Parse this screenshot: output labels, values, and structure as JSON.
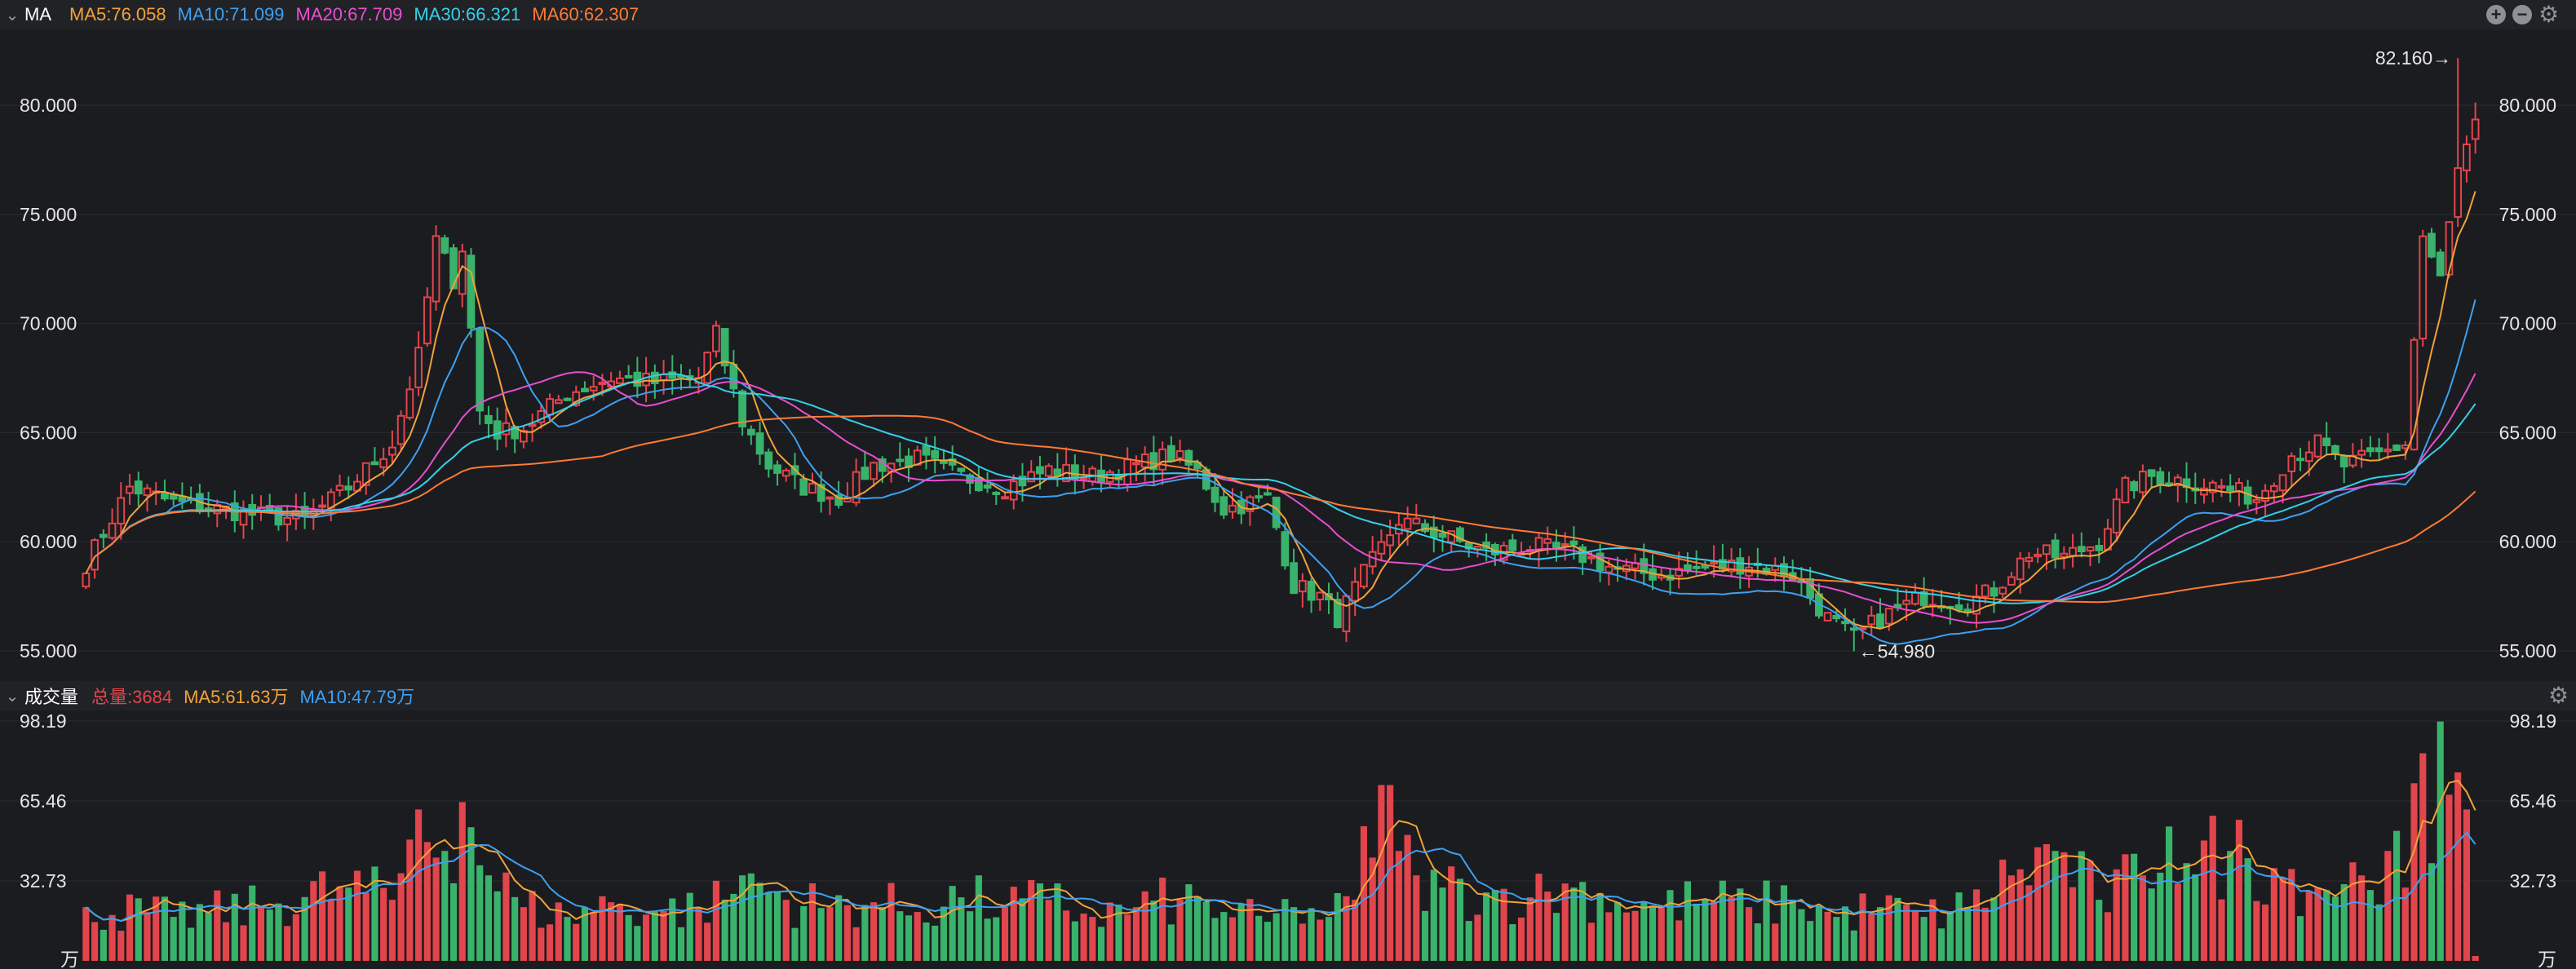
{
  "price_panel": {
    "name": "MA",
    "ma_labels": [
      {
        "text": "MA5:76.058",
        "color": "#f0a33a"
      },
      {
        "text": "MA10:71.099",
        "color": "#3ea0f2"
      },
      {
        "text": "MA20:67.709",
        "color": "#e84ed0"
      },
      {
        "text": "MA30:66.321",
        "color": "#34d0e8"
      },
      {
        "text": "MA60:62.307",
        "color": "#ff7a35"
      }
    ],
    "y_ticks": [
      "80.000",
      "75.000",
      "70.000",
      "65.000",
      "60.000",
      "55.000"
    ],
    "max_label": "82.160→",
    "min_label": "←54.980"
  },
  "volume_panel": {
    "name": "成交量",
    "total_label": "总量:3684",
    "ma5_label": "MA5:61.63万",
    "ma10_label": "MA10:47.79万",
    "y_ticks": [
      "98.19",
      "65.46",
      "32.73",
      "万"
    ]
  },
  "icons": {
    "add": "plus-circle-icon",
    "remove": "minus-circle-icon",
    "settings": "gear-icon",
    "collapse": "chevron-down-icon"
  },
  "colors": {
    "up": "#e2454c",
    "down": "#39b36b",
    "background": "#1b1c20",
    "header": "#212226"
  },
  "chart_data": [
    {
      "type": "candlestick",
      "title": "MA",
      "ylim": [
        55,
        80
      ],
      "y_ticks": [
        80,
        75,
        70,
        65,
        60,
        55
      ],
      "grid": true,
      "highest": 82.16,
      "lowest": 54.98,
      "anchors_close": [
        [
          0,
          59.0
        ],
        [
          5,
          62.5
        ],
        [
          10,
          61.8
        ],
        [
          15,
          61.5
        ],
        [
          20,
          61.2
        ],
        [
          25,
          61.0
        ],
        [
          30,
          62.5
        ],
        [
          35,
          64.5
        ],
        [
          38,
          68.5
        ],
        [
          40,
          73.8
        ],
        [
          42,
          72.0
        ],
        [
          43,
          73.5
        ],
        [
          45,
          66.0
        ],
        [
          47,
          65.0
        ],
        [
          50,
          65.2
        ],
        [
          55,
          66.8
        ],
        [
          60,
          67.5
        ],
        [
          65,
          67.3
        ],
        [
          70,
          67.5
        ],
        [
          72,
          69.5
        ],
        [
          75,
          65.5
        ],
        [
          78,
          63.5
        ],
        [
          82,
          62.5
        ],
        [
          86,
          62.0
        ],
        [
          90,
          63.5
        ],
        [
          95,
          63.8
        ],
        [
          100,
          63.0
        ],
        [
          105,
          62.5
        ],
        [
          110,
          63.3
        ],
        [
          115,
          63.0
        ],
        [
          120,
          63.5
        ],
        [
          124,
          64.0
        ],
        [
          127,
          63.2
        ],
        [
          130,
          61.5
        ],
        [
          135,
          62.0
        ],
        [
          138,
          58.0
        ],
        [
          141,
          57.5
        ],
        [
          143,
          56.5
        ],
        [
          146,
          58.5
        ],
        [
          150,
          61.0
        ],
        [
          155,
          60.3
        ],
        [
          160,
          59.5
        ],
        [
          165,
          59.8
        ],
        [
          170,
          59.5
        ],
        [
          175,
          58.7
        ],
        [
          180,
          58.5
        ],
        [
          185,
          58.8
        ],
        [
          190,
          59.0
        ],
        [
          195,
          58.5
        ],
        [
          199,
          56.5
        ],
        [
          202,
          55.6
        ],
        [
          205,
          56.5
        ],
        [
          210,
          57.5
        ],
        [
          215,
          57.2
        ],
        [
          218,
          57.8
        ],
        [
          222,
          59.5
        ],
        [
          226,
          59.3
        ],
        [
          230,
          60.0
        ],
        [
          233,
          62.5
        ],
        [
          236,
          63.0
        ],
        [
          240,
          62.8
        ],
        [
          244,
          62.5
        ],
        [
          248,
          62.0
        ],
        [
          252,
          64.0
        ],
        [
          255,
          64.5
        ],
        [
          258,
          63.5
        ],
        [
          262,
          64.0
        ],
        [
          265,
          64.5
        ],
        [
          267,
          74.0
        ],
        [
          269,
          72.0
        ],
        [
          271,
          77.0
        ],
        [
          273,
          79.0
        ]
      ],
      "moving_averages": [
        {
          "name": "MA5",
          "period": 5,
          "last": 76.058,
          "color": "#f0a33a"
        },
        {
          "name": "MA10",
          "period": 10,
          "last": 71.099,
          "color": "#3ea0f2"
        },
        {
          "name": "MA20",
          "period": 20,
          "last": 67.709,
          "color": "#e84ed0"
        },
        {
          "name": "MA30",
          "period": 30,
          "last": 66.321,
          "color": "#34d0e8"
        },
        {
          "name": "MA60",
          "period": 60,
          "last": 62.307,
          "color": "#ff7a35"
        }
      ]
    },
    {
      "type": "bar",
      "title": "成交量",
      "unit": "万",
      "ylim": [
        0,
        98.19
      ],
      "y_ticks": [
        98.19,
        65.46,
        32.73
      ],
      "total": 3684,
      "anchors_volume": [
        [
          0,
          22
        ],
        [
          10,
          18
        ],
        [
          20,
          22
        ],
        [
          30,
          30
        ],
        [
          35,
          25
        ],
        [
          38,
          62
        ],
        [
          41,
          45
        ],
        [
          43,
          65
        ],
        [
          46,
          35
        ],
        [
          50,
          22
        ],
        [
          55,
          18
        ],
        [
          60,
          24
        ],
        [
          65,
          20
        ],
        [
          70,
          22
        ],
        [
          73,
          25
        ],
        [
          75,
          35
        ],
        [
          80,
          25
        ],
        [
          85,
          22
        ],
        [
          90,
          24
        ],
        [
          95,
          20
        ],
        [
          100,
          26
        ],
        [
          105,
          22
        ],
        [
          110,
          25
        ],
        [
          115,
          18
        ],
        [
          120,
          22
        ],
        [
          125,
          25
        ],
        [
          130,
          20
        ],
        [
          135,
          16
        ],
        [
          138,
          22
        ],
        [
          142,
          18
        ],
        [
          145,
          25
        ],
        [
          148,
          72
        ],
        [
          150,
          45
        ],
        [
          152,
          35
        ],
        [
          155,
          30
        ],
        [
          160,
          28
        ],
        [
          165,
          26
        ],
        [
          170,
          30
        ],
        [
          175,
          24
        ],
        [
          180,
          22
        ],
        [
          185,
          25
        ],
        [
          190,
          22
        ],
        [
          195,
          25
        ],
        [
          200,
          18
        ],
        [
          205,
          22
        ],
        [
          210,
          18
        ],
        [
          215,
          22
        ],
        [
          220,
          35
        ],
        [
          225,
          45
        ],
        [
          230,
          25
        ],
        [
          235,
          35
        ],
        [
          238,
          55
        ],
        [
          240,
          40
        ],
        [
          245,
          45
        ],
        [
          250,
          38
        ],
        [
          255,
          30
        ],
        [
          260,
          35
        ],
        [
          263,
          45
        ],
        [
          265,
          30
        ],
        [
          267,
          85
        ],
        [
          268,
          40
        ],
        [
          269,
          98
        ],
        [
          270,
          68
        ],
        [
          272,
          62
        ],
        [
          273,
          2
        ]
      ],
      "moving_averages": [
        {
          "name": "MA5",
          "period": 5,
          "last": 61.63,
          "color": "#f0a33a"
        },
        {
          "name": "MA10",
          "period": 10,
          "last": 47.79,
          "color": "#3ea0f2"
        }
      ]
    }
  ]
}
